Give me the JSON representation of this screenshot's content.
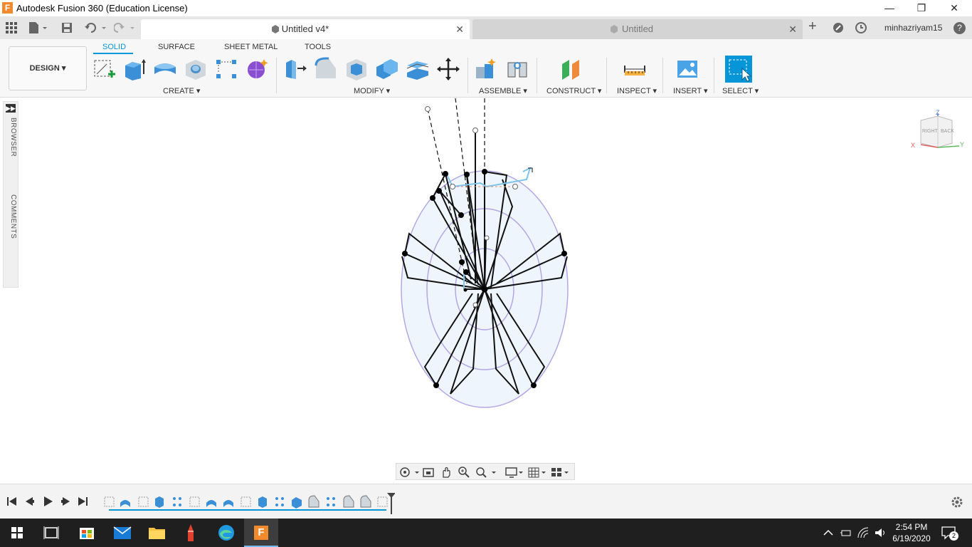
{
  "window": {
    "title": "Autodesk Fusion 360 (Education License)",
    "app_icon_letter": "F",
    "minimize": "—",
    "restore": "❐",
    "close": "✕"
  },
  "tabs": {
    "active_label": "Untitled v4*",
    "inactive_label": "Untitled",
    "close_glyph": "✕",
    "new_tab": "+",
    "user": "minhazriyam15",
    "help": "?"
  },
  "toolbar": {
    "workspace": "DESIGN ▾",
    "tabs": [
      "SOLID",
      "SURFACE",
      "SHEET METAL",
      "TOOLS"
    ],
    "groups": {
      "create": "CREATE ▾",
      "modify": "MODIFY ▾",
      "assemble": "ASSEMBLE ▾",
      "construct": "CONSTRUCT ▾",
      "inspect": "INSPECT ▾",
      "insert": "INSERT ▾",
      "select": "SELECT ▾"
    }
  },
  "side": {
    "browser": "BROWSER",
    "comments": "COMMENTS"
  },
  "viewcube": {
    "top": "Z",
    "face_right": "RIGHT",
    "face_back": "BACK",
    "axis_x": "X",
    "axis_y": "Y"
  },
  "taskbar": {
    "time": "2:54 PM",
    "date": "6/19/2020",
    "notifications": "2"
  },
  "colors": {
    "accent": "#0696d7",
    "sketch_fill": "#eef5fc",
    "sketch_circle": "#b4a7e6",
    "selected_blue": "#7ec3ea"
  }
}
